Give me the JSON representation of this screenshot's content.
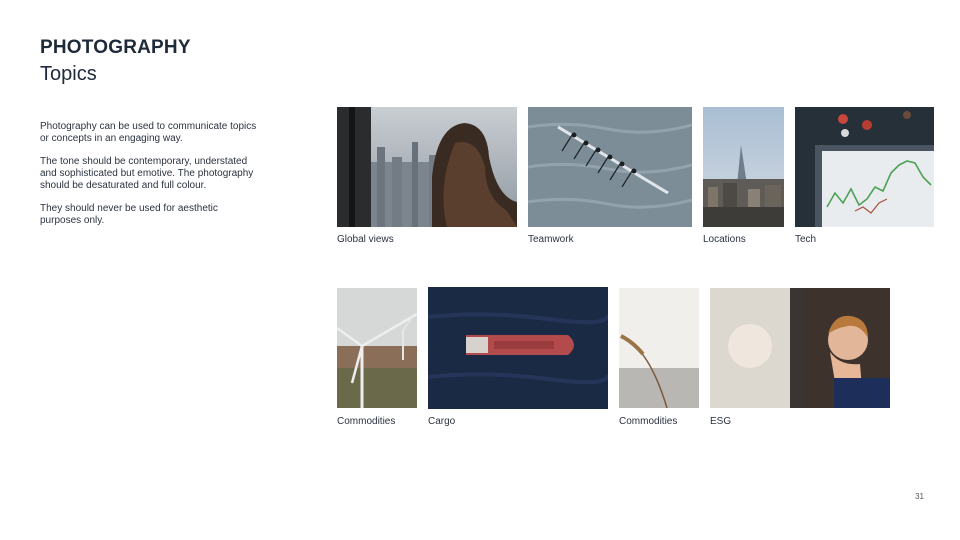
{
  "heading": {
    "title": "PHOTOGRAPHY",
    "subtitle": "Topics"
  },
  "body": {
    "p1": "Photography can be used to communicate topics or concepts in an engaging way.",
    "p2": "The tone should be contemporary, understated and sophisticated but emotive. The photography should be desaturated and full colour.",
    "p3": "They should never be used for aesthetic purposes only."
  },
  "photos": {
    "row1": [
      {
        "caption": "Global views"
      },
      {
        "caption": "Teamwork"
      },
      {
        "caption": "Locations"
      },
      {
        "caption": "Tech"
      }
    ],
    "row2": [
      {
        "caption": "Commodities"
      },
      {
        "caption": "Cargo"
      },
      {
        "caption": "Commodities"
      },
      {
        "caption": "ESG"
      }
    ]
  },
  "page_number": "31"
}
